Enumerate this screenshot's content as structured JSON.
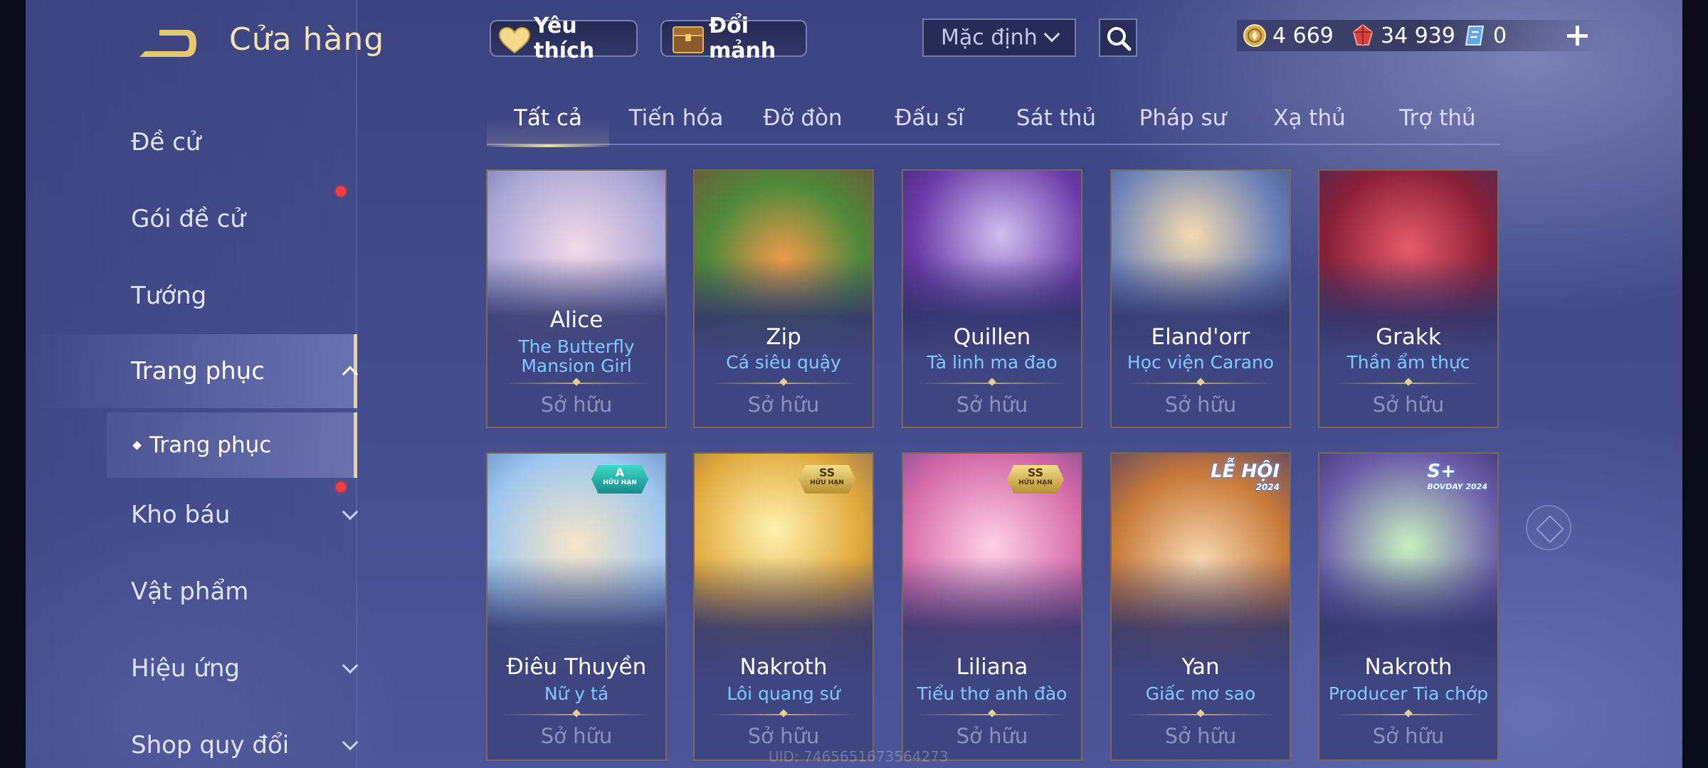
{
  "header": {
    "title": "Cửa hàng",
    "favorites_label": "Yêu thích",
    "exchange_label": "Đổi mảnh",
    "sort_label": "Mặc định"
  },
  "currencies": [
    {
      "name": "gold-coin-icon",
      "value": "4 669"
    },
    {
      "name": "ruby-gem-icon",
      "value": "34 939"
    },
    {
      "name": "voucher-icon",
      "value": "0"
    }
  ],
  "sidebar": {
    "items": [
      {
        "label": "Đề cử"
      },
      {
        "label": "Gói đề cử"
      },
      {
        "label": "Tướng"
      },
      {
        "label": "Trang phục"
      },
      {
        "label": "Kho báu"
      },
      {
        "label": "Vật phẩm"
      },
      {
        "label": "Hiệu ứng"
      },
      {
        "label": "Shop quy đổi"
      }
    ],
    "sub_item": "Trang phục"
  },
  "tabs": [
    "Tất cả",
    "Tiến hóa",
    "Đỡ đòn",
    "Đấu sĩ",
    "Sát thủ",
    "Pháp sư",
    "Xạ thủ",
    "Trợ thủ"
  ],
  "owned_label": "Sở hữu",
  "cards_row1": [
    {
      "hero": "Alice",
      "skin": "The Butterfly Mansion Girl"
    },
    {
      "hero": "Zip",
      "skin": "Cá siêu quậy"
    },
    {
      "hero": "Quillen",
      "skin": "Tà linh ma đao"
    },
    {
      "hero": "Eland'orr",
      "skin": "Học viện Carano"
    },
    {
      "hero": "Grakk",
      "skin": "Thần ẩm thực"
    }
  ],
  "cards_row2": [
    {
      "hero": "Điêu Thuyền",
      "skin": "Nữ y tá",
      "badge": "A",
      "badge_sub": "HỮU HẠN"
    },
    {
      "hero": "Nakroth",
      "skin": "Lôi quang sứ",
      "badge": "SS",
      "badge_sub": "HỮU HẠN"
    },
    {
      "hero": "Liliana",
      "skin": "Tiểu thơ anh đào",
      "badge": "SS",
      "badge_sub": "HỮU HẠN"
    },
    {
      "hero": "Yan",
      "skin": "Giấc mơ sao",
      "badge": "LỄ HỘI",
      "badge_sub": "2024"
    },
    {
      "hero": "Nakroth",
      "skin": "Producer Tia chớp",
      "badge": "S+",
      "badge_sub": "BOVDAY 2024"
    }
  ],
  "uid_text": "UID: 7465651673564273"
}
